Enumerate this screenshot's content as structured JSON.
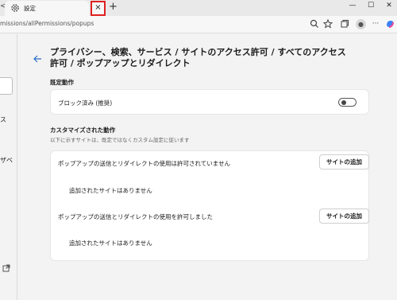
{
  "tab": {
    "title": "設定",
    "close_glyph": "×",
    "new_tab_glyph": "+"
  },
  "window_controls": {
    "minimize": "—",
    "maximize": "☐",
    "close": "✕"
  },
  "address_bar": {
    "url": "missions/allPermissions/popups"
  },
  "left_nav": {
    "fragments": [
      "ス",
      "ザベ"
    ]
  },
  "page": {
    "title": "プライバシー、検索、サービス / サイトのアクセス許可 / すべてのアクセス許可 / ポップアップとリダイレクト"
  },
  "default_section": {
    "heading": "既定動作",
    "option_label": "ブロック済み (推奨)",
    "toggle_on": false
  },
  "custom_section": {
    "heading": "カスタマイズされた動作",
    "description": "以下に示すサイトは、既定ではなくカスタム設定に従います",
    "blocked": {
      "label": "ポップアップの送信とリダイレクトの使用は許可されていません",
      "add_button": "サイトの追加",
      "empty_text": "追加されたサイトはありません"
    },
    "allowed": {
      "label": "ポップアップの送信とリダイレクトの使用を許可しました",
      "add_button": "サイトの追加",
      "empty_text": "追加されたサイトはありません"
    }
  },
  "colors": {
    "highlight": "#e02020",
    "background": "#f3f3f3",
    "card": "#ffffff"
  }
}
